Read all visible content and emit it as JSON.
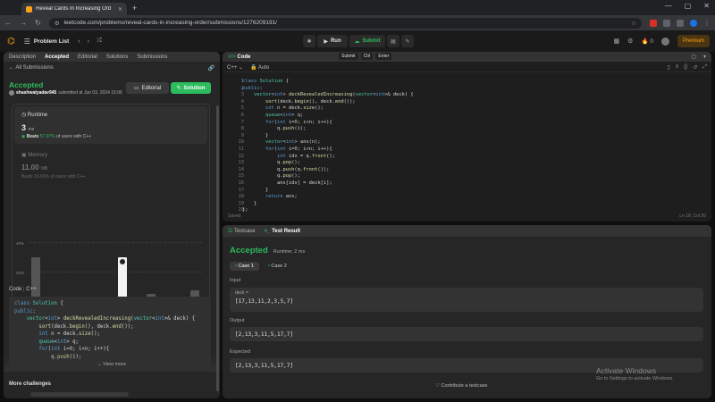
{
  "browser": {
    "tab_title": "Reveal Cards In Increasing Ord",
    "url": "leetcode.com/problems/reveal-cards-in-increasing-order/submissions/1276209191/",
    "newtab": "+",
    "win_min": "—",
    "win_max": "▢",
    "win_close": "✕"
  },
  "header": {
    "problem_list": "Problem List",
    "run": "Run",
    "submit": "Submit",
    "streak": "0",
    "premium": "Premium"
  },
  "left": {
    "tabs": [
      "Description",
      "Accepted",
      "Editorial",
      "Solutions",
      "Submissions"
    ],
    "all_submissions": "All Submissions",
    "status": "Accepted",
    "user": "shashwatyadav945",
    "submitted_at": "submitted at Jun 03, 2024 15:06",
    "editorial_btn": "Editorial",
    "solution_btn": "Solution",
    "runtime_label": "Runtime",
    "runtime_value": "3",
    "runtime_unit": "ms",
    "beats_label": "Beats",
    "beats_value": "57.97%",
    "beats_suffix": "of users with C++",
    "memory_label": "Memory",
    "memory_value": "11.00",
    "memory_unit": "MB",
    "memory_beats": "Beats 16.65% of users with C++",
    "chart_y_ticks": [
      "40%",
      "20%",
      "0%"
    ],
    "chart_x_ticks": [
      "1ms",
      "2ms",
      "3ms",
      "4ms",
      "5ms",
      "6ms"
    ],
    "code_section": "Code",
    "code_lang": "C++",
    "code_lines": [
      "class Solution {",
      "public:",
      "    vector<int> deckRevealedIncreasing(vector<int>& deck) {",
      "        sort(deck.begin(), deck.end());",
      "        int n = deck.size();",
      "        queue<int> q;",
      "        for(int i=0; i<n; i++){",
      "            q.push(i);"
    ],
    "view_more": "View more",
    "more_challenges": "More challenges"
  },
  "chart_data": {
    "type": "bar",
    "categories": [
      "",
      "1ms",
      "",
      "2ms",
      "",
      "3ms",
      "",
      "4ms",
      "",
      "5ms",
      "",
      "6ms"
    ],
    "values": [
      30,
      1,
      1,
      0.5,
      1,
      1,
      30,
      1,
      5,
      1,
      1,
      7
    ],
    "ylabel": "",
    "ylim": [
      0,
      40
    ],
    "highlight_index": 6
  },
  "editor": {
    "title": "Code",
    "lang": "C++",
    "mode": "Auto",
    "shortcut": [
      "Submit",
      "Ctrl",
      "Enter"
    ],
    "saved": "Saved",
    "cursor": "Ln 18, Col 20",
    "lines": [
      "class Solution {",
      "public:",
      "    vector<int> deckRevealedIncreasing(vector<int>& deck) {",
      "        sort(deck.begin(), deck.end());",
      "        int n = deck.size();",
      "        queue<int> q;",
      "        for(int i=0; i<n; i++){",
      "            q.push(i);",
      "        }",
      "        vector<int> ans(n);",
      "        for(int i=0; i<n; i++){",
      "            int idx = q.front();",
      "            q.pop();",
      "            q.push(q.front());",
      "            q.pop();",
      "            ans[idx] = deck[i];",
      "        }",
      "        return ans;",
      "    }",
      "};"
    ],
    "line_numbers": [
      "1",
      "2",
      "3",
      "4",
      "5",
      "6",
      "7",
      "8",
      "9",
      "10",
      "11",
      "12",
      "13",
      "14",
      "15",
      "16",
      "17",
      "18",
      "19",
      "20"
    ]
  },
  "test": {
    "tab_testcase": "Testcase",
    "tab_result": "Test Result",
    "status": "Accepted",
    "runtime": "Runtime: 2 ms",
    "case1": "Case 1",
    "case2": "Case 2",
    "input_label": "Input",
    "param": "deck =",
    "input_value": "[17,13,11,2,3,5,7]",
    "output_label": "Output",
    "output_value": "[2,13,3,11,5,17,7]",
    "expected_label": "Expected",
    "expected_value": "[2,13,3,11,5,17,7]",
    "contribute": "Contribute a testcase"
  },
  "watermark": {
    "line1": "Activate Windows",
    "line2": "Go to Settings to activate Windows."
  },
  "colors": {
    "accent_green": "#2cbb5d",
    "accent_orange": "#ffa116"
  }
}
